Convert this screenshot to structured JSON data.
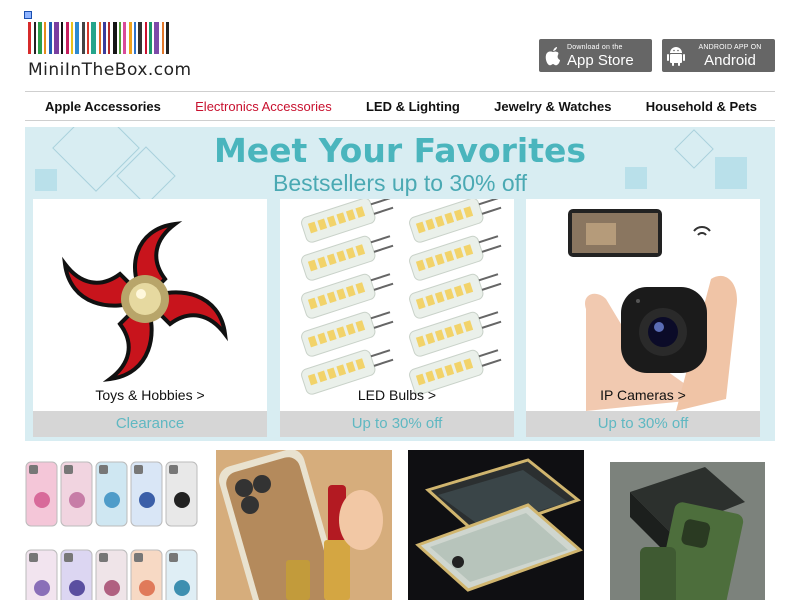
{
  "header": {
    "logo_text": "MiniInTheBox.com",
    "barcode_colors": [
      "#d62b2b",
      "#222",
      "#2aa04a",
      "#e58c1a",
      "#1f5fb5",
      "#7a3fa0",
      "#111",
      "#c61e5e",
      "#e9c21c",
      "#2d8ad1",
      "#444",
      "#d9372a",
      "#25a58b",
      "#e06d22",
      "#3b3b9c",
      "#b22a2a",
      "#161616",
      "#58a13a",
      "#d94a9a",
      "#f0a21c",
      "#2e73c9",
      "#333",
      "#c8102e",
      "#1a9a6b",
      "#7d4aa8",
      "#e3782a",
      "#222"
    ],
    "app_store": {
      "small": "Download on the",
      "big": "App Store",
      "icon": "apple-icon"
    },
    "android": {
      "small": "ANDROID APP ON",
      "big": "Android",
      "icon": "android-icon"
    }
  },
  "nav": {
    "items": [
      {
        "label": "Apple Accessories",
        "active": false
      },
      {
        "label": "Electronics Accessories",
        "active": true
      },
      {
        "label": "LED & Lighting",
        "active": false
      },
      {
        "label": "Jewelry & Watches",
        "active": false
      },
      {
        "label": "Household & Pets",
        "active": false
      }
    ],
    "active_color": "#c8102e"
  },
  "banner": {
    "title": "Meet Your Favorites",
    "subtitle": "Bestsellers up to 30% off",
    "accent": "#4ab5bd",
    "cards": [
      {
        "label": "Toys & Hobbies >",
        "promo": "Clearance",
        "image": "fidget-spinner-image"
      },
      {
        "label": "LED Bulbs >",
        "promo": "Up to 30% off",
        "image": "led-bulbs-image"
      },
      {
        "label": "IP Cameras >",
        "promo": "Up to 30% off",
        "image": "ip-camera-image"
      }
    ]
  },
  "products": [
    {
      "image": "phone-cases-image"
    },
    {
      "image": "mirror-phone-case-image"
    },
    {
      "image": "magnetic-glass-case-image"
    },
    {
      "image": "green-phone-case-image"
    }
  ]
}
